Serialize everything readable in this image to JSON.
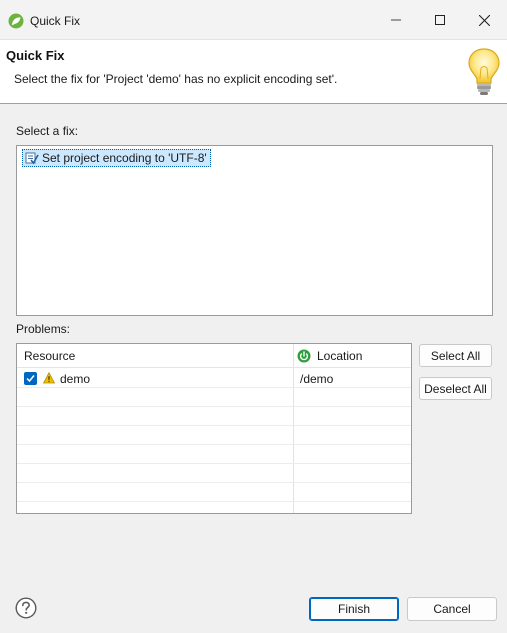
{
  "window": {
    "title": "Quick Fix",
    "minimize_icon": "minimize-icon",
    "maximize_icon": "maximize-icon",
    "close_icon": "close-icon"
  },
  "header": {
    "title": "Quick Fix",
    "message": "Select the fix for 'Project 'demo' has no explicit encoding set'.",
    "icon": "lightbulb-icon"
  },
  "fix_section": {
    "label": "Select a fix:",
    "items": [
      {
        "label": "Set project encoding to 'UTF-8'",
        "icon": "change-icon",
        "selected": true
      }
    ]
  },
  "problems": {
    "label": "Problems:",
    "columns": {
      "resource": "Resource",
      "location": "Location",
      "location_icon": "spring-icon"
    },
    "rows": [
      {
        "checked": true,
        "warning": true,
        "resource": "demo",
        "location": "/demo"
      }
    ],
    "select_all": "Select All",
    "deselect_all": "Deselect All"
  },
  "footer": {
    "help_icon": "help-icon",
    "finish": "Finish",
    "cancel": "Cancel"
  },
  "colors": {
    "accent": "#0067c0",
    "selection": "#cce8ff",
    "warning": "#f2c200",
    "spring": "#2e9e3e"
  }
}
